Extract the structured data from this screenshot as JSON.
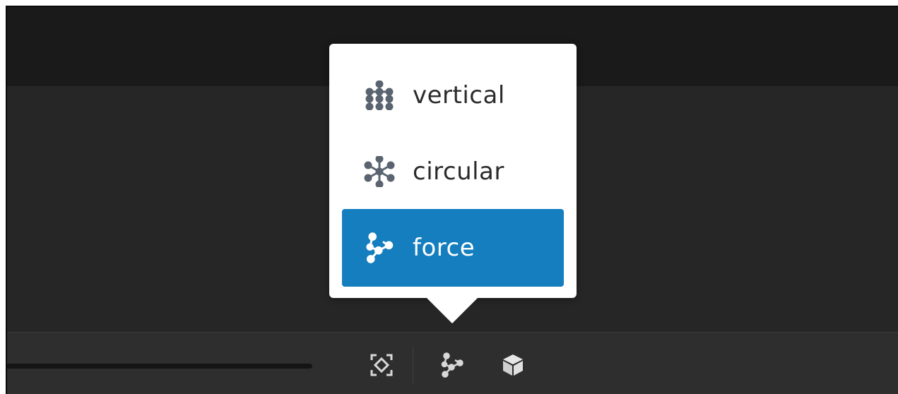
{
  "colors": {
    "background": "#262626",
    "top_bar": "#1a1a1a",
    "bottom_bar": "#2e2e2f",
    "popover": "#ffffff",
    "selected": "#147ebf",
    "icon_gray": "#5a6470",
    "toolbar_icon": "#d8d8d8"
  },
  "layout_menu": {
    "items": [
      {
        "label": "vertical",
        "icon": "vertical-tree-icon",
        "selected": false
      },
      {
        "label": "circular",
        "icon": "circular-layout-icon",
        "selected": false
      },
      {
        "label": "force",
        "icon": "force-layout-icon",
        "selected": true
      }
    ]
  },
  "toolbar": {
    "buttons": [
      {
        "name": "fit-to-screen",
        "icon": "fit-screen-icon"
      },
      {
        "name": "layout-selector",
        "icon": "force-layout-icon"
      },
      {
        "name": "3d-view",
        "icon": "cube-icon"
      }
    ]
  }
}
